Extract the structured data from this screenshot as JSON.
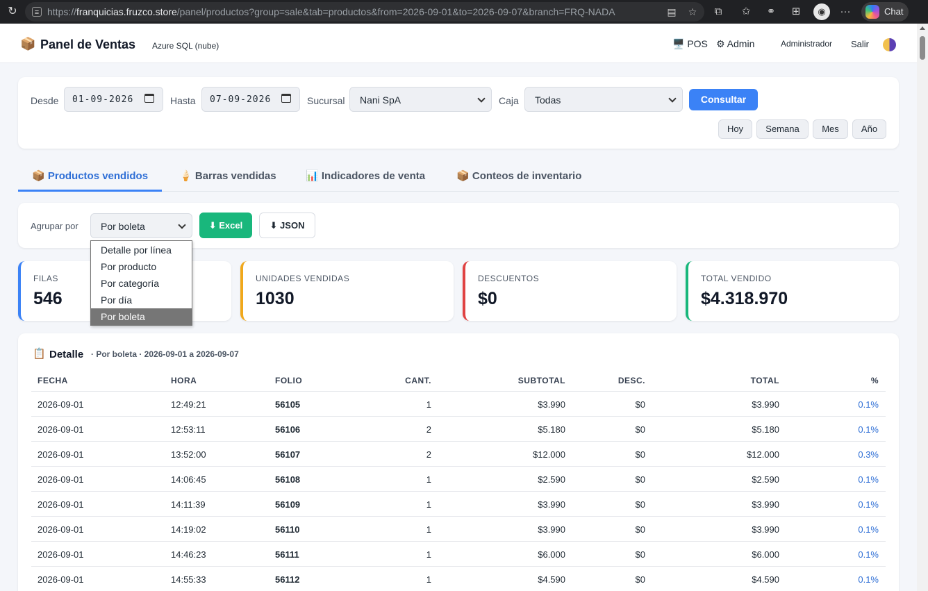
{
  "browser": {
    "url_host": "franquicias.fruzco.store",
    "url_path": "/panel/productos?group=sale&tab=productos&from=2026-09-01&to=2026-09-07&branch=FRQ-NADA",
    "url_scheme": "https://",
    "chat_label": "Chat"
  },
  "header": {
    "icon": "📦",
    "title": "Panel de Ventas",
    "subtitle": "Azure SQL (nube)",
    "nav_pos": "🖥️ POS",
    "nav_admin": "⚙ Admin",
    "user": "Administrador",
    "logout": "Salir"
  },
  "filters": {
    "from_label": "Desde",
    "from_value": "01-09-2026",
    "to_label": "Hasta",
    "to_value": "07-09-2026",
    "branch_label": "Sucursal",
    "branch_value": "Nani SpA",
    "register_label": "Caja",
    "register_value": "Todas",
    "submit_label": "Consultar",
    "quick": [
      "Hoy",
      "Semana",
      "Mes",
      "Año"
    ]
  },
  "tabs": [
    {
      "icon": "📦",
      "label": "Productos vendidos",
      "active": true
    },
    {
      "icon": "🍦",
      "label": "Barras vendidas",
      "active": false
    },
    {
      "icon": "📊",
      "label": "Indicadores de venta",
      "active": false
    },
    {
      "icon": "📦",
      "label": "Conteos de inventario",
      "active": false
    }
  ],
  "group": {
    "label": "Agrupar por",
    "value": "Por boleta",
    "options": [
      "Detalle por línea",
      "Por producto",
      "Por categoría",
      "Por día",
      "Por boleta"
    ],
    "excel_label": "⬇ Excel",
    "json_label": "⬇ JSON"
  },
  "stats": [
    {
      "label": "FILAS",
      "value": "546",
      "color": "#3b82f6"
    },
    {
      "label": "UNIDADES VENDIDAS",
      "value": "1030",
      "color": "#f0a81c"
    },
    {
      "label": "DESCUENTOS",
      "value": "$0",
      "color": "#e04343"
    },
    {
      "label": "TOTAL VENDIDO",
      "value": "$4.318.970",
      "color": "#19b77c"
    }
  ],
  "detail": {
    "icon": "📋",
    "title": "Detalle",
    "subtitle": "· Por boleta · 2026-09-01 a 2026-09-07",
    "columns": [
      "FECHA",
      "HORA",
      "FOLIO",
      "CANT.",
      "SUBTOTAL",
      "DESC.",
      "TOTAL",
      "%"
    ],
    "rows": [
      [
        "2026-09-01",
        "12:49:21",
        "56105",
        "1",
        "$3.990",
        "$0",
        "$3.990",
        "0.1%"
      ],
      [
        "2026-09-01",
        "12:53:11",
        "56106",
        "2",
        "$5.180",
        "$0",
        "$5.180",
        "0.1%"
      ],
      [
        "2026-09-01",
        "13:52:00",
        "56107",
        "2",
        "$12.000",
        "$0",
        "$12.000",
        "0.3%"
      ],
      [
        "2026-09-01",
        "14:06:45",
        "56108",
        "1",
        "$2.590",
        "$0",
        "$2.590",
        "0.1%"
      ],
      [
        "2026-09-01",
        "14:11:39",
        "56109",
        "1",
        "$3.990",
        "$0",
        "$3.990",
        "0.1%"
      ],
      [
        "2026-09-01",
        "14:19:02",
        "56110",
        "1",
        "$3.990",
        "$0",
        "$3.990",
        "0.1%"
      ],
      [
        "2026-09-01",
        "14:46:23",
        "56111",
        "1",
        "$6.000",
        "$0",
        "$6.000",
        "0.1%"
      ],
      [
        "2026-09-01",
        "14:55:33",
        "56112",
        "1",
        "$4.590",
        "$0",
        "$4.590",
        "0.1%"
      ]
    ]
  },
  "colors": {
    "accent": "#3b82f6",
    "excel": "#19b77c",
    "link": "#2f6fd6"
  }
}
